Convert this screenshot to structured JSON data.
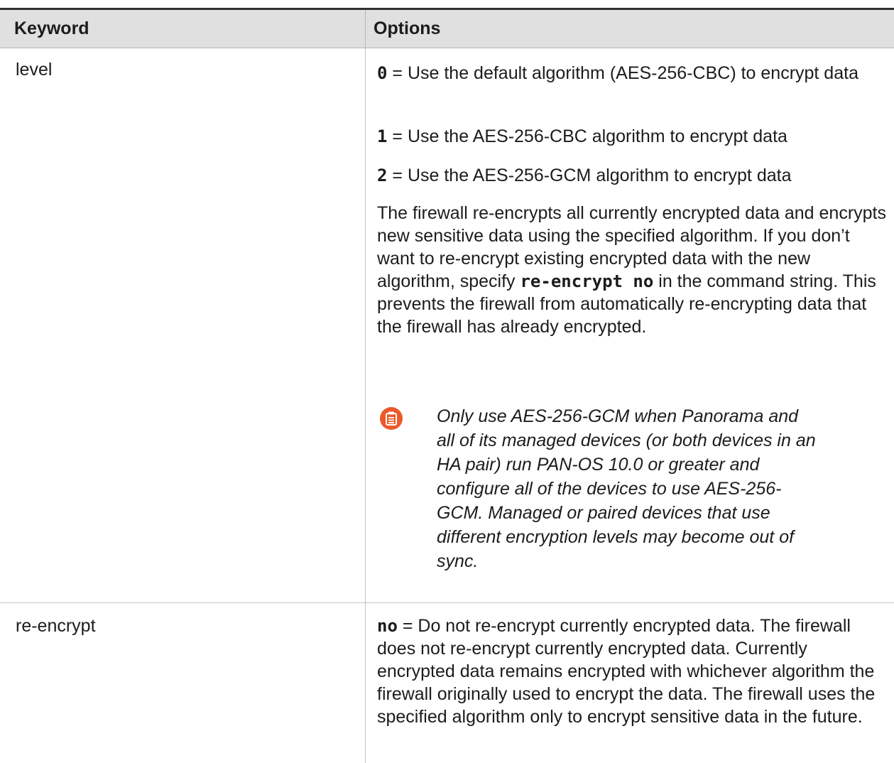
{
  "table": {
    "headers": {
      "keyword": "Keyword",
      "options": "Options"
    },
    "rows": [
      {
        "keyword": "level",
        "options": [
          {
            "code": "0",
            "text": " = Use the default algorithm (AES-256-CBC) to encrypt data"
          },
          {
            "code": "1",
            "text": " = Use the AES-256-CBC algorithm to encrypt data"
          },
          {
            "code": "2",
            "text": " = Use the AES-256-GCM algorithm to encrypt data"
          }
        ],
        "paragraph": {
          "text_before": "The firewall re-encrypts all currently encrypted data and encrypts new sensitive data using the specified algorithm. If you don’t want to re-encrypt existing encrypted data with the new algorithm, specify ",
          "code": "re-encrypt no",
          "text_after": " in the command string. This prevents the firewall from automatically re-encrypting data that the firewall has already encrypted."
        },
        "note": {
          "icon": "clipboard-note-icon",
          "icon_color": "#ea5a2b",
          "text": "Only use AES-256-GCM when Panorama and all of its managed devices (or both devices in an HA pair) run PAN-OS 10.0 or greater and configure all of the devices to use AES-256-GCM. Managed or paired devices that use different encryption levels may become out of sync."
        }
      },
      {
        "keyword": "re-encrypt",
        "options": [
          {
            "code": "no",
            "text": " = Do not re-encrypt currently encrypted data. The firewall does not re-encrypt currently encrypted data. Currently encrypted data remains encrypted with whichever algorithm the firewall originally used to encrypt the data. The firewall uses the specified algorithm only to encrypt sensitive data in the future."
          }
        ]
      }
    ]
  },
  "colors": {
    "header_bg": "#e0e0e0",
    "border": "#c4c4c4",
    "text": "#1c1c1c",
    "note_icon": "#ea5a2b"
  }
}
